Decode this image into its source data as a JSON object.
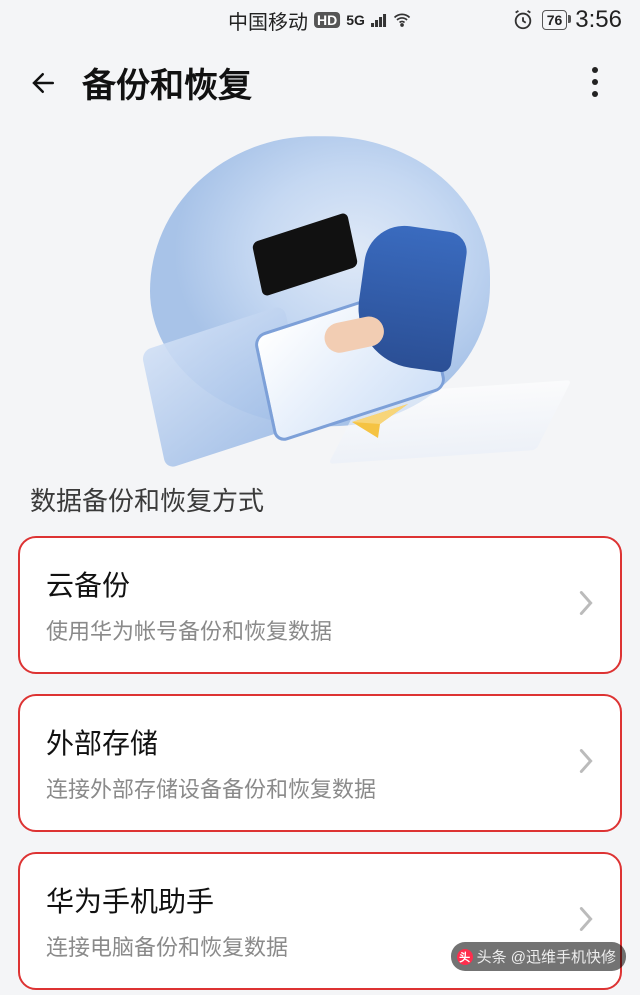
{
  "status": {
    "carrier": "中国移动",
    "hd_badge": "HD",
    "net_label": "5G",
    "battery_pct": "76",
    "time": "3:56"
  },
  "header": {
    "title": "备份和恢复"
  },
  "section_title": "数据备份和恢复方式",
  "items": [
    {
      "title": "云备份",
      "subtitle": "使用华为帐号备份和恢复数据"
    },
    {
      "title": "外部存储",
      "subtitle": "连接外部存储设备备份和恢复数据"
    },
    {
      "title": "华为手机助手",
      "subtitle": "连接电脑备份和恢复数据"
    }
  ],
  "watermark": "头条 @迅维手机快修"
}
